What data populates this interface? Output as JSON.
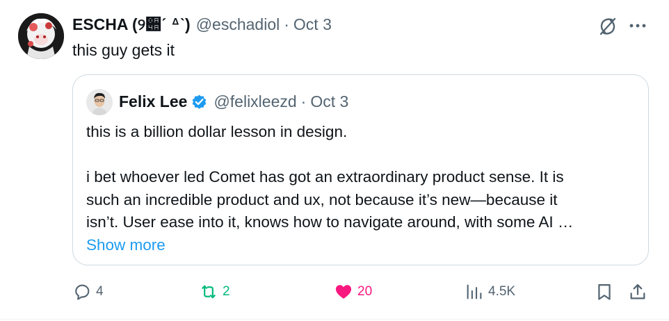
{
  "tweet": {
    "author_name": "ESCHA (୨੊ˊ ᐞˋ)",
    "author_handle": "@eschadiol",
    "separator": "·",
    "date": "Oct 3",
    "text": "this guy gets it"
  },
  "quote": {
    "author_name": "Felix Lee",
    "author_handle": "@felixleezd",
    "separator": "·",
    "date": "Oct 3",
    "line1": "this is a billion dollar lesson in design.",
    "line2": "i bet whoever led Comet has got an extraordinary product sense. It is",
    "line3": "such an incredible product and ux, not because it’s new—because it",
    "line4": "isn’t. User ease into it, knows how to navigate around, with some AI …",
    "show_more": "Show more"
  },
  "actions": {
    "replies": "4",
    "reposts": "2",
    "likes": "20",
    "views": "4.5K"
  },
  "colors": {
    "text_primary": "#0f1419",
    "text_secondary": "#536471",
    "link": "#1d9bf0",
    "repost_active": "#00ba7c",
    "like_active": "#f91880",
    "verified": "#1d9bf0",
    "border": "#cfd9de"
  },
  "icons": {
    "reply": "reply-icon",
    "repost": "repost-icon",
    "like": "heart-icon",
    "views": "views-icon",
    "bookmark": "bookmark-icon",
    "share": "share-icon",
    "grok": "grok-icon",
    "more": "more-icon",
    "verified": "verified-badge-icon"
  }
}
